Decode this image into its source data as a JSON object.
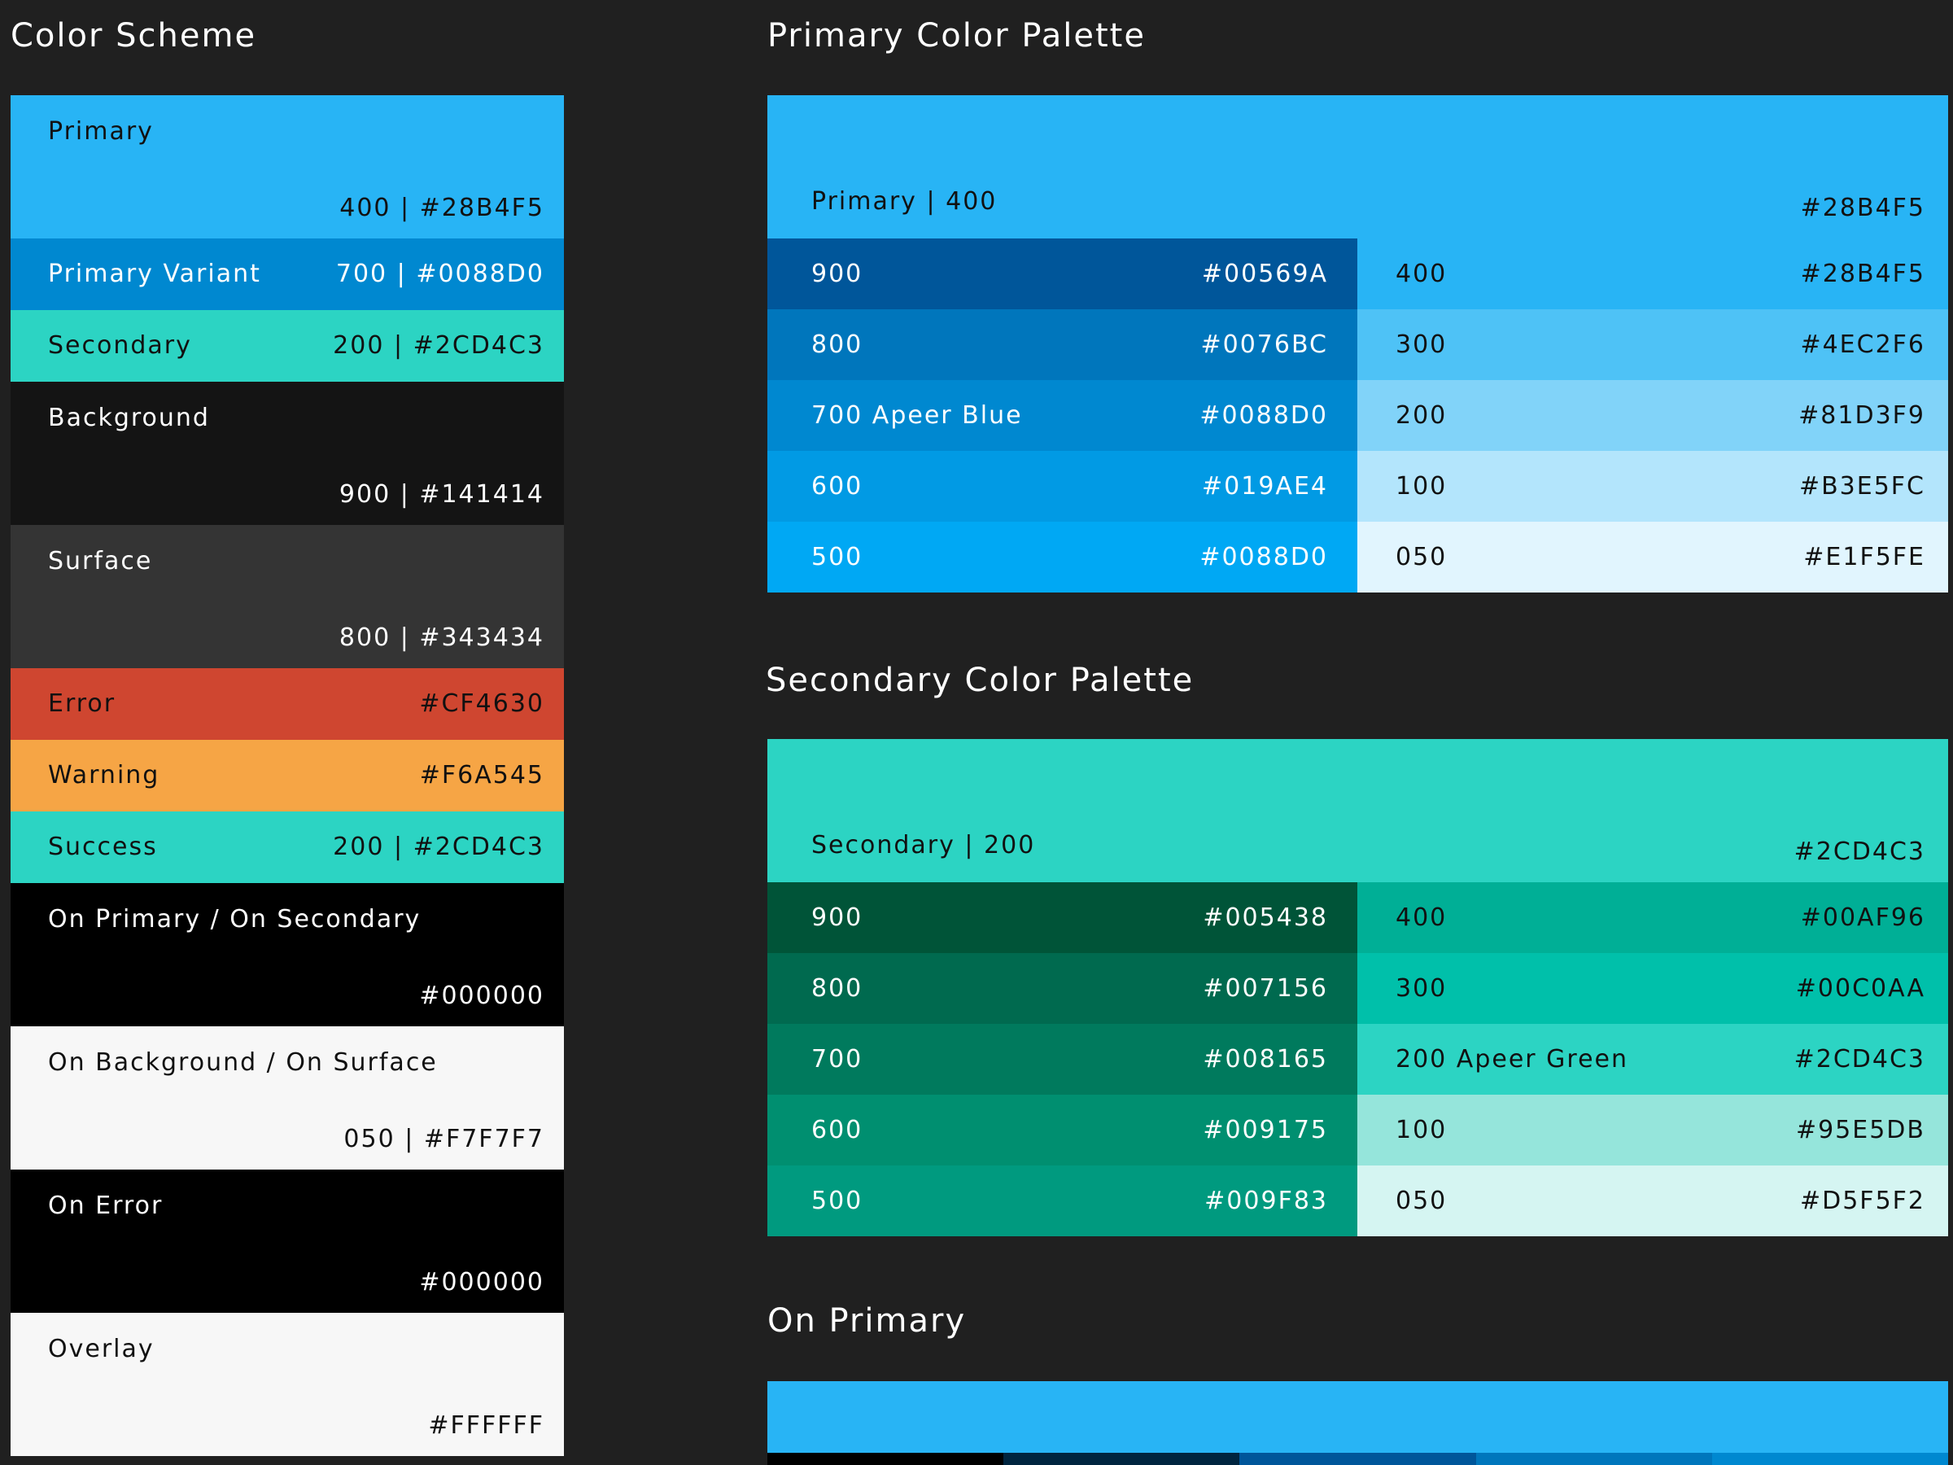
{
  "scheme": {
    "title": "Color Scheme",
    "swatches": [
      {
        "name": "Primary",
        "code": "400 | #28B4F5",
        "bg": "#28B4F5",
        "fg": "#111111",
        "h": 176
      },
      {
        "name": "Primary Variant",
        "code": "700 | #0088D0",
        "bg": "#0088D0",
        "fg": "#FFFFFF",
        "h": 88
      },
      {
        "name": "Secondary",
        "code": "200 | #2CD4C3",
        "bg": "#2CD4C3",
        "fg": "#111111",
        "h": 88
      },
      {
        "name": "Background",
        "code": "900 | #141414",
        "bg": "#141414",
        "fg": "#FFFFFF",
        "h": 176
      },
      {
        "name": "Surface",
        "code": "800 | #343434",
        "bg": "#343434",
        "fg": "#FFFFFF",
        "h": 176
      },
      {
        "name": "Error",
        "code": "#CF4630",
        "bg": "#CF4630",
        "fg": "#111111",
        "h": 88
      },
      {
        "name": "Warning",
        "code": "#F6A545",
        "bg": "#F6A545",
        "fg": "#111111",
        "h": 88
      },
      {
        "name": "Success",
        "code": "200 | #2CD4C3",
        "bg": "#2CD4C3",
        "fg": "#111111",
        "h": 88
      },
      {
        "name": "On Primary / On Secondary",
        "code": "#000000",
        "bg": "#000000",
        "fg": "#FFFFFF",
        "h": 176
      },
      {
        "name": "On Background / On Surface",
        "code": "050 | #F7F7F7",
        "bg": "#F7F7F7",
        "fg": "#111111",
        "h": 176
      },
      {
        "name": "On Error",
        "code": "#000000",
        "bg": "#000000",
        "fg": "#FFFFFF",
        "h": 176
      },
      {
        "name": "Overlay",
        "code": "#FFFFFF",
        "bg": "#F7F7F7",
        "fg": "#111111",
        "h": 176
      }
    ]
  },
  "primary_palette": {
    "title": "Primary Color Palette",
    "hero": {
      "name": "Primary | 400",
      "code": "#28B4F5",
      "bg": "#28B4F5",
      "fg": "#111111"
    },
    "left": [
      {
        "level": "900",
        "hex": "#00569A",
        "bg": "#00569A",
        "fg": "#FFFFFF"
      },
      {
        "level": "800",
        "hex": "#0076BC",
        "bg": "#0076BC",
        "fg": "#FFFFFF"
      },
      {
        "level": "700 Apeer Blue",
        "hex": "#0088D0",
        "bg": "#0088D0",
        "fg": "#FFFFFF"
      },
      {
        "level": "600",
        "hex": "#019AE4",
        "bg": "#019AE4",
        "fg": "#FFFFFF"
      },
      {
        "level": "500",
        "hex": "#0088D0",
        "bg": "#00A8F4",
        "fg": "#FFFFFF"
      }
    ],
    "right": [
      {
        "level": "400",
        "hex": "#28B4F5",
        "bg": "#28B4F5",
        "fg": "#111111"
      },
      {
        "level": "300",
        "hex": "#4EC2F6",
        "bg": "#4EC2F6",
        "fg": "#111111"
      },
      {
        "level": "200",
        "hex": "#81D3F9",
        "bg": "#81D3F9",
        "fg": "#111111"
      },
      {
        "level": "100",
        "hex": "#B3E5FC",
        "bg": "#B3E5FC",
        "fg": "#111111"
      },
      {
        "level": "050",
        "hex": "#E1F5FE",
        "bg": "#E1F5FE",
        "fg": "#111111"
      }
    ]
  },
  "secondary_palette": {
    "title": "Secondary Color Palette",
    "hero": {
      "name": "Secondary | 200",
      "code": "#2CD4C3",
      "bg": "#2CD4C3",
      "fg": "#111111"
    },
    "left": [
      {
        "level": "900",
        "hex": "#005438",
        "bg": "#005438",
        "fg": "#FFFFFF"
      },
      {
        "level": "800",
        "hex": "#007156",
        "bg": "#006A4F",
        "fg": "#FFFFFF"
      },
      {
        "level": "700",
        "hex": "#008165",
        "bg": "#007A5D",
        "fg": "#FFFFFF"
      },
      {
        "level": "600",
        "hex": "#009175",
        "bg": "#008F70",
        "fg": "#FFFFFF"
      },
      {
        "level": "500",
        "hex": "#009F83",
        "bg": "#009A7F",
        "fg": "#FFFFFF"
      }
    ],
    "right": [
      {
        "level": "400",
        "hex": "#00AF96",
        "bg": "#00AF96",
        "fg": "#111111"
      },
      {
        "level": "300",
        "hex": "#00C0AA",
        "bg": "#00C0AA",
        "fg": "#111111"
      },
      {
        "level": "200 Apeer Green",
        "hex": "#2CD4C3",
        "bg": "#2CD4C3",
        "fg": "#111111"
      },
      {
        "level": "100",
        "hex": "#95E5DB",
        "bg": "#95E5DB",
        "fg": "#111111"
      },
      {
        "level": "050",
        "hex": "#D5F5F2",
        "bg": "#D5F5F2",
        "fg": "#111111"
      }
    ]
  },
  "on_primary": {
    "title": "On Primary",
    "bar_color": "#28B4F5",
    "strip_colors": [
      "#000000",
      "#00253F",
      "#00569A",
      "#0076BC",
      "#0088D0"
    ]
  }
}
